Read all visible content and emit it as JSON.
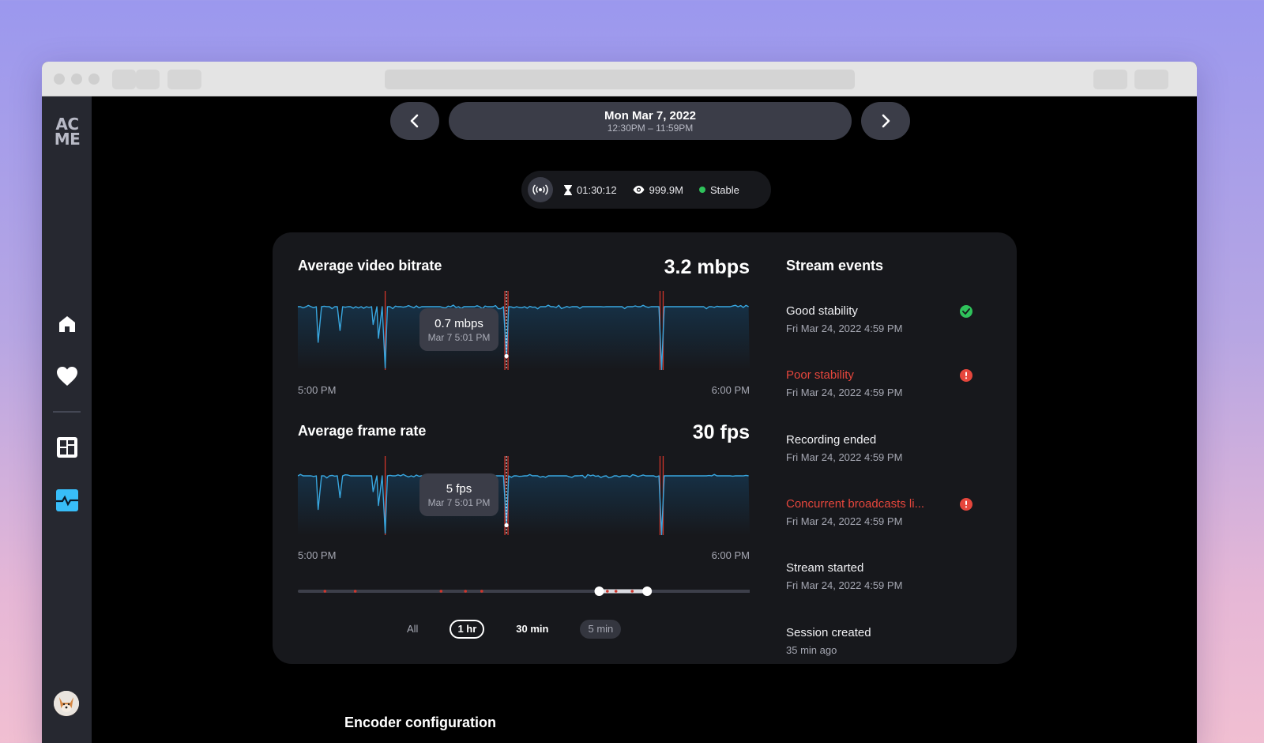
{
  "app": {
    "logo": "AC ME"
  },
  "sidebar": {
    "items": [
      {
        "name": "home",
        "icon": "home-icon",
        "active": false
      },
      {
        "name": "favorites",
        "icon": "heart-icon",
        "active": false
      },
      {
        "name": "dashboard",
        "icon": "dashboard-icon",
        "active": false
      },
      {
        "name": "monitoring",
        "icon": "activity-icon",
        "active": true
      }
    ],
    "accent": "#38bdf8"
  },
  "date_nav": {
    "date": "Mon Mar 7, 2022",
    "time_range": "12:30PM – 11:59PM",
    "prev_icon": "chevron-left-icon",
    "next_icon": "chevron-right-icon"
  },
  "status": {
    "live_icon": "broadcast-icon",
    "duration": "01:30:12",
    "viewers": "999.9M",
    "stability": "Stable",
    "stability_color": "#2fc25b"
  },
  "bitrate": {
    "title": "Average video bitrate",
    "value": "3.2 mbps",
    "tooltip_value": "0.7 mbps",
    "tooltip_date": "Mar 7 5:01 PM",
    "x_start": "5:00 PM",
    "x_end": "6:00 PM"
  },
  "framerate": {
    "title": "Average frame rate",
    "value": "30 fps",
    "tooltip_value": "5 fps",
    "tooltip_date": "Mar 7 5:01 PM",
    "x_start": "5:00 PM",
    "x_end": "6:00 PM"
  },
  "timeline": {
    "selection_start": 0.667,
    "selection_end": 0.773,
    "event_markers": [
      0.06,
      0.127,
      0.317,
      0.371,
      0.407,
      0.685,
      0.704,
      0.74
    ]
  },
  "range_buttons": [
    {
      "label": "All",
      "state": "normal"
    },
    {
      "label": "1 hr",
      "state": "selected"
    },
    {
      "label": "30 min",
      "state": "bold"
    },
    {
      "label": "5 min",
      "state": "muted"
    }
  ],
  "events": {
    "title": "Stream events",
    "items": [
      {
        "title": "Good stability",
        "date": "Fri Mar 24, 2022 4:59 PM",
        "status": "success"
      },
      {
        "title": "Poor stability",
        "date": "Fri Mar 24, 2022 4:59 PM",
        "status": "error"
      },
      {
        "title": "Recording ended",
        "date": "Fri Mar 24, 2022 4:59 PM",
        "status": "none"
      },
      {
        "title": "Concurrent broadcasts li...",
        "date": "Fri Mar 24, 2022 4:59 PM",
        "status": "error"
      },
      {
        "title": "Stream started",
        "date": "Fri Mar 24, 2022 4:59 PM",
        "status": "none"
      },
      {
        "title": "Session created",
        "date": "35 min ago",
        "status": "none"
      }
    ],
    "colors": {
      "success": "#2fc25b",
      "error": "#e5463c"
    }
  },
  "encoder": {
    "title": "Encoder configuration"
  },
  "chart_data": [
    {
      "type": "line",
      "title": "Average video bitrate",
      "xlabel": "",
      "ylabel": "mbps",
      "x_ticks": [
        "5:00 PM",
        "6:00 PM"
      ],
      "x_range": [
        0,
        60
      ],
      "y_range": [
        0,
        4
      ],
      "baseline": 3.2,
      "dips": [
        {
          "minute": 2.7,
          "value": 1.4
        },
        {
          "minute": 5.6,
          "value": 2.0
        },
        {
          "minute": 10.0,
          "value": 2.3
        },
        {
          "minute": 10.7,
          "value": 1.6
        },
        {
          "minute": 11.6,
          "value": 0.1
        },
        {
          "minute": 27.7,
          "value": 0.7
        },
        {
          "minute": 48.3,
          "value": 0.0
        }
      ],
      "incident_minutes": [
        11.6,
        27.7,
        48.3
      ],
      "highlight": {
        "minute": 27.7,
        "value": 0.7,
        "label": "0.7 mbps",
        "date": "Mar 7 5:01 PM"
      },
      "line_color": "#38a7e0",
      "incident_color": "#d0352b"
    },
    {
      "type": "line",
      "title": "Average frame rate",
      "xlabel": "",
      "ylabel": "fps",
      "x_ticks": [
        "5:00 PM",
        "6:00 PM"
      ],
      "x_range": [
        0,
        60
      ],
      "y_range": [
        0,
        40
      ],
      "baseline": 30,
      "dips": [
        {
          "minute": 2.7,
          "value": 13
        },
        {
          "minute": 5.6,
          "value": 19
        },
        {
          "minute": 10.0,
          "value": 22
        },
        {
          "minute": 10.7,
          "value": 15
        },
        {
          "minute": 11.6,
          "value": 1
        },
        {
          "minute": 27.7,
          "value": 5
        },
        {
          "minute": 48.3,
          "value": 0
        }
      ],
      "incident_minutes": [
        11.6,
        27.7,
        48.3
      ],
      "highlight": {
        "minute": 27.7,
        "value": 5,
        "label": "5 fps",
        "date": "Mar 7 5:01 PM"
      },
      "line_color": "#38a7e0",
      "incident_color": "#d0352b"
    }
  ]
}
